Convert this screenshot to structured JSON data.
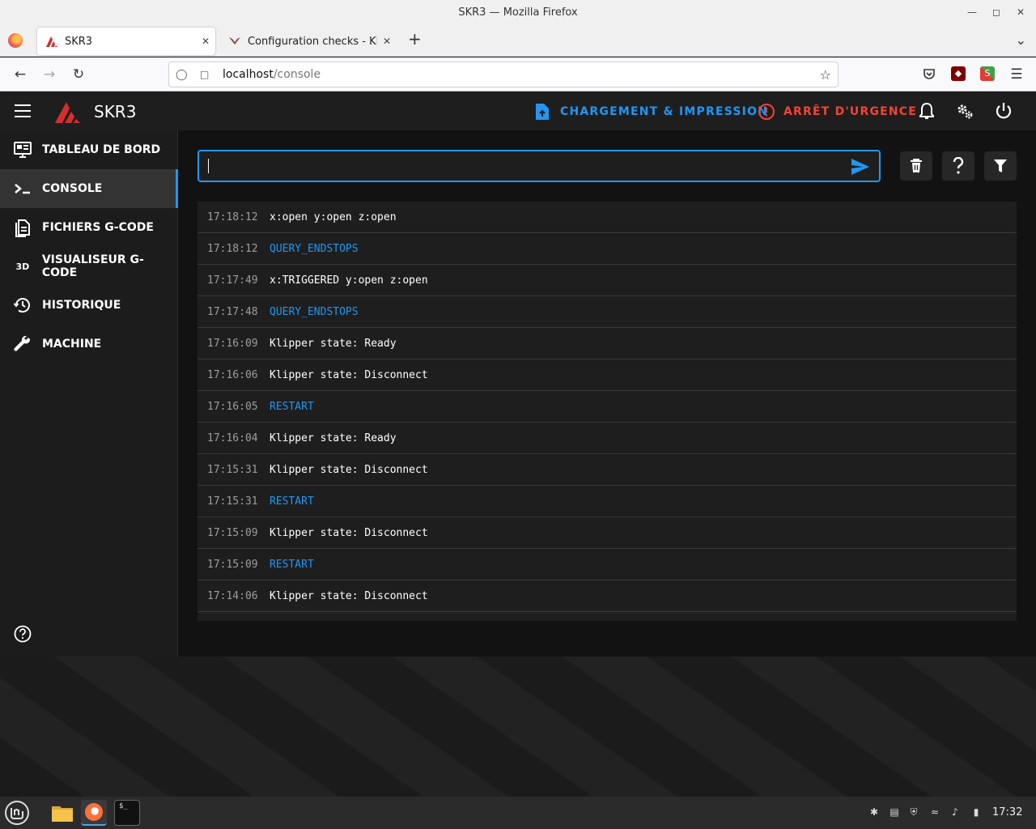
{
  "window": {
    "title": "SKR3 — Mozilla Firefox"
  },
  "tabs": [
    {
      "title": "SKR3",
      "active": true
    },
    {
      "title": "Configuration checks - Klipp",
      "active": false
    }
  ],
  "url": {
    "host": "localhost",
    "path": "/console"
  },
  "app": {
    "name": "SKR3",
    "upload_label": "CHARGEMENT & IMPRESSION",
    "estop_label": "ARRÊT D'URGENCE",
    "colors": {
      "accent": "#2196f3",
      "danger": "#f44336",
      "brand_red": "#d32f2f"
    }
  },
  "sidebar": {
    "items": [
      {
        "label": "TABLEAU DE BORD",
        "icon": "monitor-dashboard-icon",
        "active": false
      },
      {
        "label": "CONSOLE",
        "icon": "console-icon",
        "active": true
      },
      {
        "label": "FICHIERS G-CODE",
        "icon": "file-document-icon",
        "active": false
      },
      {
        "label": "VISUALISEUR G-CODE",
        "icon": "3d-icon",
        "active": false
      },
      {
        "label": "HISTORIQUE",
        "icon": "history-icon",
        "active": false
      },
      {
        "label": "MACHINE",
        "icon": "wrench-icon",
        "active": false
      }
    ],
    "icon_3d_text": "3D"
  },
  "console": {
    "input_value": "",
    "entries": [
      {
        "time": "17:18:12",
        "message": "x:open y:open z:open",
        "type": "response"
      },
      {
        "time": "17:18:12",
        "message": "QUERY_ENDSTOPS",
        "type": "command"
      },
      {
        "time": "17:17:49",
        "message": "x:TRIGGERED y:open z:open",
        "type": "response"
      },
      {
        "time": "17:17:48",
        "message": "QUERY_ENDSTOPS",
        "type": "command"
      },
      {
        "time": "17:16:09",
        "message": "Klipper state: Ready",
        "type": "response"
      },
      {
        "time": "17:16:06",
        "message": "Klipper state: Disconnect",
        "type": "response"
      },
      {
        "time": "17:16:05",
        "message": "RESTART",
        "type": "command"
      },
      {
        "time": "17:16:04",
        "message": "Klipper state: Ready",
        "type": "response"
      },
      {
        "time": "17:15:31",
        "message": "Klipper state: Disconnect",
        "type": "response"
      },
      {
        "time": "17:15:31",
        "message": "RESTART",
        "type": "command"
      },
      {
        "time": "17:15:09",
        "message": "Klipper state: Disconnect",
        "type": "response"
      },
      {
        "time": "17:15:09",
        "message": "RESTART",
        "type": "command"
      },
      {
        "time": "17:14:06",
        "message": "Klipper state: Disconnect",
        "type": "response"
      }
    ]
  },
  "taskbar": {
    "clock": "17:32"
  }
}
